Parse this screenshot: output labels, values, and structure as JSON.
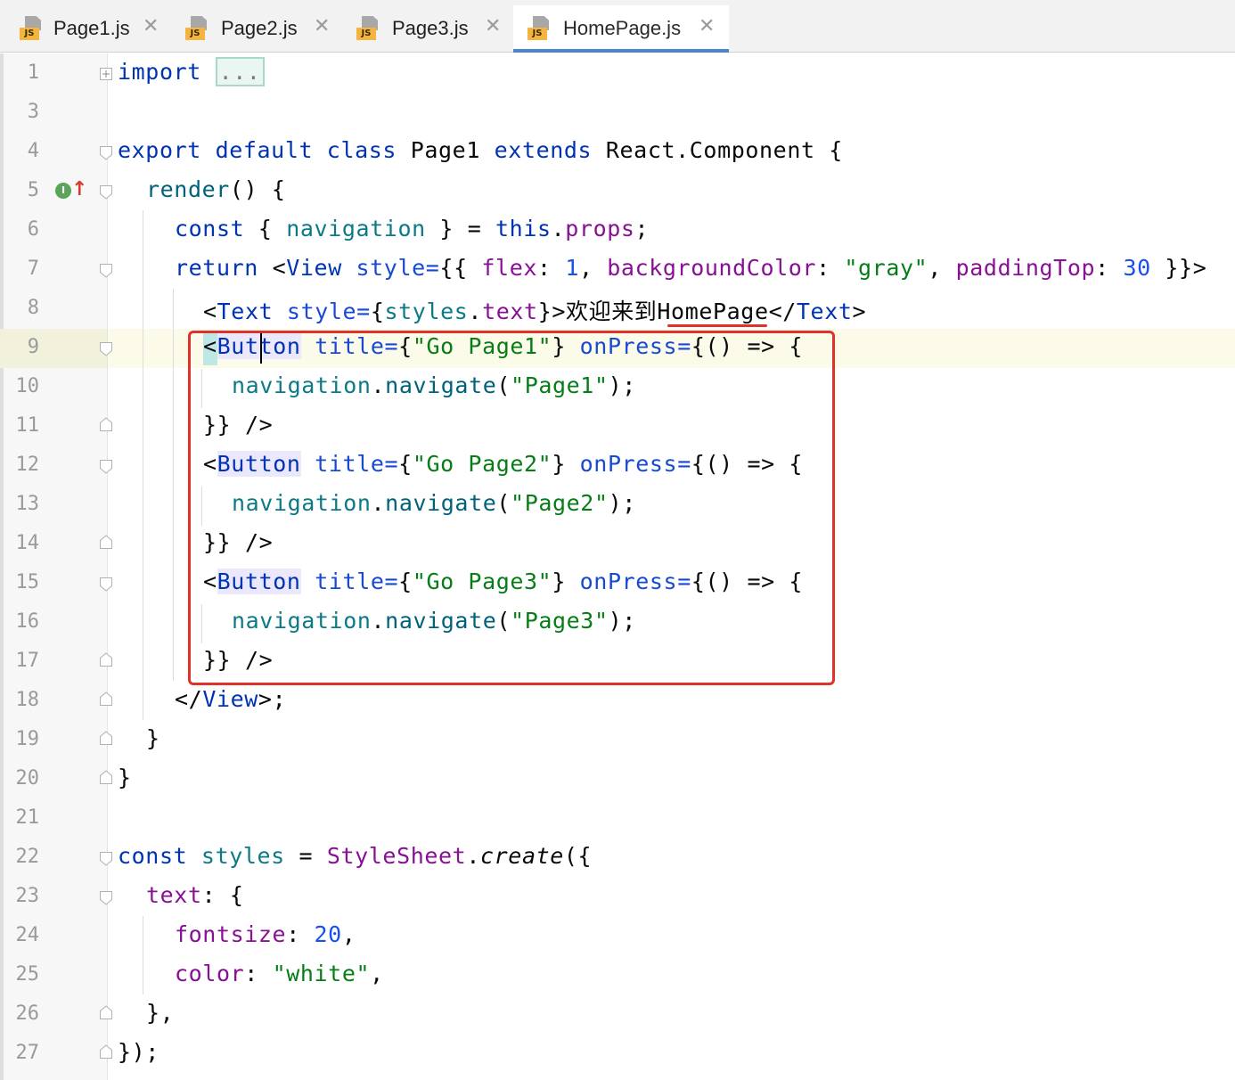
{
  "tabs": [
    {
      "name": "Page1.js",
      "icon": "js-file-icon",
      "active": false
    },
    {
      "name": "Page2.js",
      "icon": "js-file-icon",
      "active": false
    },
    {
      "name": "Page3.js",
      "icon": "js-file-icon",
      "active": false
    },
    {
      "name": "HomePage.js",
      "icon": "js-file-icon",
      "active": true
    }
  ],
  "tab_icon_text": "JS",
  "close_glyph": "✕",
  "gutter": {
    "implements_marker": "I",
    "override_arrow": "↑"
  },
  "line_numbers": [
    "1",
    "3",
    "4",
    "5",
    "6",
    "7",
    "8",
    "9",
    "10",
    "11",
    "12",
    "13",
    "14",
    "15",
    "16",
    "17",
    "18",
    "19",
    "20",
    "21",
    "22",
    "23",
    "24",
    "25",
    "26",
    "27"
  ],
  "code": {
    "l1": {
      "kw": "import",
      "collapsed": "..."
    },
    "l4": {
      "t1": "export",
      "t2": "default",
      "t3": "class",
      "t4": "Page1",
      "t5": "extends",
      "t6": "React.Component {"
    },
    "l5": {
      "t1": "render",
      "t2": "() {"
    },
    "l6": {
      "t1": "const",
      "t2": " { ",
      "t3": "navigation",
      "t4": " } = ",
      "t5": "this",
      "t6": ".",
      "t7": "props",
      "t8": ";"
    },
    "l7": {
      "t1": "return",
      "t2": " <",
      "t3": "View",
      "t4": " ",
      "t5": "style=",
      "t6": "{{ ",
      "t7": "flex",
      "t8": ": ",
      "t9": "1",
      "t10": ", ",
      "t11": "backgroundColor",
      "t12": ": ",
      "t13": "\"gray\"",
      "t14": ", ",
      "t15": "paddingTop",
      "t16": ": ",
      "t17": "30",
      "t18": " }}>"
    },
    "l8": {
      "t1": "<",
      "t2": "Text",
      "t3": " ",
      "t4": "style=",
      "t5": "{",
      "t6": "styles",
      "t7": ".",
      "t8": "text",
      "t9": "}>欢迎来到HomePage</",
      "t10": "Text",
      "t11": ">"
    },
    "l9": {
      "t1": "<",
      "t2": "Button",
      "t3": " ",
      "t4": "title=",
      "t5": "{",
      "t6": "\"Go Page1\"",
      "t7": "} ",
      "t8": "onPress=",
      "t9": "{() => {"
    },
    "l10": {
      "t1": "navigation",
      "t2": ".",
      "t3": "navigate",
      "t4": "(",
      "t5": "\"Page1\"",
      "t6": ");"
    },
    "l11": {
      "t1": "}} />"
    },
    "l12": {
      "t1": "<",
      "t2": "Button",
      "t3": " ",
      "t4": "title=",
      "t5": "{",
      "t6": "\"Go Page2\"",
      "t7": "} ",
      "t8": "onPress=",
      "t9": "{() => {"
    },
    "l13": {
      "t1": "navigation",
      "t2": ".",
      "t3": "navigate",
      "t4": "(",
      "t5": "\"Page2\"",
      "t6": ");"
    },
    "l14": {
      "t1": "}} />"
    },
    "l15": {
      "t1": "<",
      "t2": "Button",
      "t3": " ",
      "t4": "title=",
      "t5": "{",
      "t6": "\"Go Page3\"",
      "t7": "} ",
      "t8": "onPress=",
      "t9": "{() => {"
    },
    "l16": {
      "t1": "navigation",
      "t2": ".",
      "t3": "navigate",
      "t4": "(",
      "t5": "\"Page3\"",
      "t6": ");"
    },
    "l17": {
      "t1": "}} />"
    },
    "l18": {
      "t1": "</",
      "t2": "View",
      "t3": ">;"
    },
    "l19": {
      "t1": "}"
    },
    "l20": {
      "t1": "}"
    },
    "l22": {
      "t1": "const",
      "t2": " ",
      "t3": "styles",
      "t4": " = ",
      "t5": "StyleSheet",
      "t6": ".",
      "t7": "create",
      "t8": "({"
    },
    "l23": {
      "t1": "text",
      "t2": ": {"
    },
    "l24": {
      "t1": "fontsize",
      "t2": ": ",
      "t3": "20",
      "t4": ","
    },
    "l25": {
      "t1": "color",
      "t2": ": ",
      "t3": "\"white\"",
      "t4": ","
    },
    "l26": {
      "t1": "},"
    },
    "l27": {
      "t1": "});"
    }
  },
  "colors": {
    "keyword": "#0033b3",
    "string": "#067d17",
    "number": "#1750eb",
    "property": "#871094",
    "annotation_box": "#e0312a",
    "tab_active_underline": "#4a86c8"
  }
}
